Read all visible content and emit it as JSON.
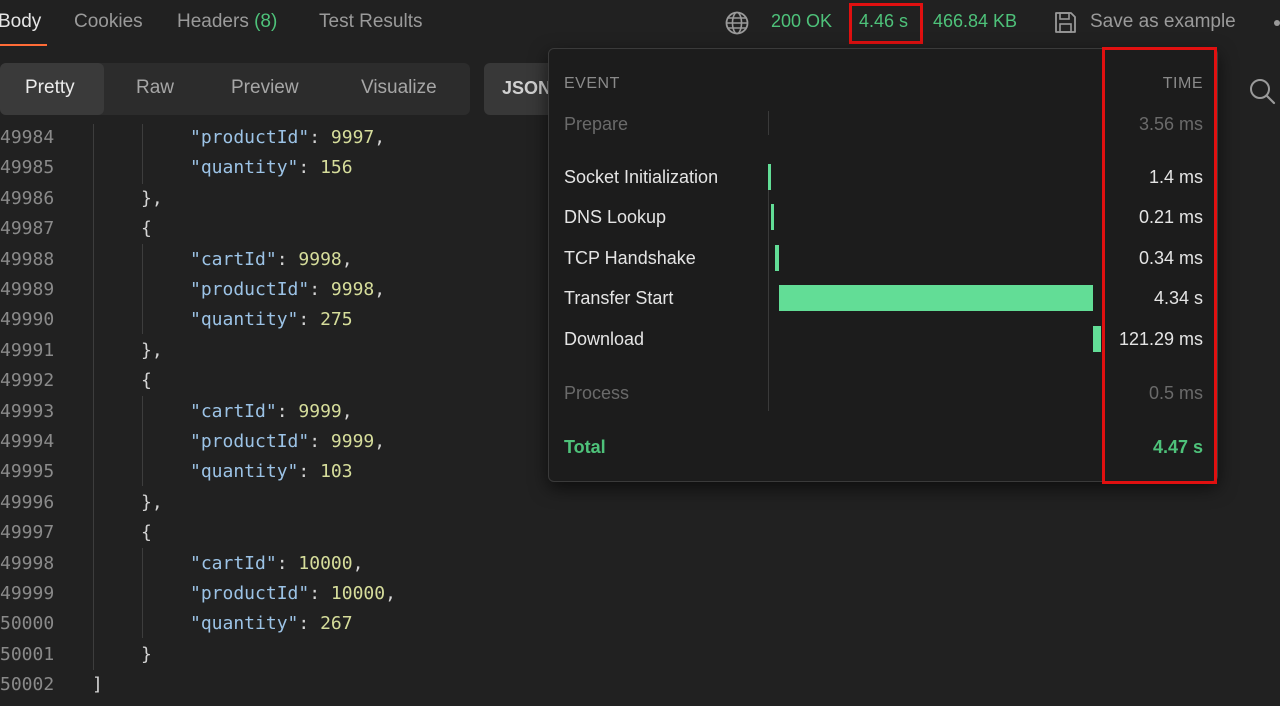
{
  "tabs": {
    "body": "Body",
    "cookies": "Cookies",
    "headers": "Headers",
    "headers_count": "(8)",
    "test_results": "Test Results"
  },
  "status": {
    "code": "200 OK",
    "time": "4.46 s",
    "size": "466.84 KB"
  },
  "save_example": "Save as example",
  "views": {
    "pretty": "Pretty",
    "raw": "Raw",
    "preview": "Preview",
    "visualize": "Visualize",
    "format": "JSON"
  },
  "code": {
    "lines": [
      {
        "num": "49984",
        "key": "\"productId\"",
        "val": "9997",
        "tail": ","
      },
      {
        "num": "49985",
        "key": "\"quantity\"",
        "val": "156",
        "tail": ""
      },
      {
        "num": "49986",
        "text": "},"
      },
      {
        "num": "49987",
        "text": "{"
      },
      {
        "num": "49988",
        "key": "\"cartId\"",
        "val": "9998",
        "tail": ","
      },
      {
        "num": "49989",
        "key": "\"productId\"",
        "val": "9998",
        "tail": ","
      },
      {
        "num": "49990",
        "key": "\"quantity\"",
        "val": "275",
        "tail": ""
      },
      {
        "num": "49991",
        "text": "},"
      },
      {
        "num": "49992",
        "text": "{"
      },
      {
        "num": "49993",
        "key": "\"cartId\"",
        "val": "9999",
        "tail": ","
      },
      {
        "num": "49994",
        "key": "\"productId\"",
        "val": "9999",
        "tail": ","
      },
      {
        "num": "49995",
        "key": "\"quantity\"",
        "val": "103",
        "tail": ""
      },
      {
        "num": "49996",
        "text": "},"
      },
      {
        "num": "49997",
        "text": "{"
      },
      {
        "num": "49998",
        "key": "\"cartId\"",
        "val": "10000",
        "tail": ","
      },
      {
        "num": "49999",
        "key": "\"productId\"",
        "val": "10000",
        "tail": ","
      },
      {
        "num": "50000",
        "key": "\"quantity\"",
        "val": "267",
        "tail": ""
      },
      {
        "num": "50001",
        "text": "}"
      },
      {
        "num": "50002",
        "text": "]"
      }
    ]
  },
  "timing": {
    "header_event": "EVENT",
    "header_time": "TIME",
    "prepare": {
      "label": "Prepare",
      "time": "3.56 ms"
    },
    "socket": {
      "label": "Socket Initialization",
      "time": "1.4 ms"
    },
    "dns": {
      "label": "DNS Lookup",
      "time": "0.21 ms"
    },
    "tcp": {
      "label": "TCP Handshake",
      "time": "0.34 ms"
    },
    "transfer": {
      "label": "Transfer Start",
      "time": "4.34 s"
    },
    "download": {
      "label": "Download",
      "time": "121.29 ms"
    },
    "process": {
      "label": "Process",
      "time": "0.5 ms"
    },
    "total": {
      "label": "Total",
      "time": "4.47 s"
    }
  },
  "colors": {
    "accent_green": "#4ec27a",
    "bar_green": "#62dd96",
    "highlight_red": "#e01010",
    "tab_underline": "#ff6c37"
  },
  "icons": [
    "globe-icon",
    "save-icon",
    "search-icon"
  ]
}
